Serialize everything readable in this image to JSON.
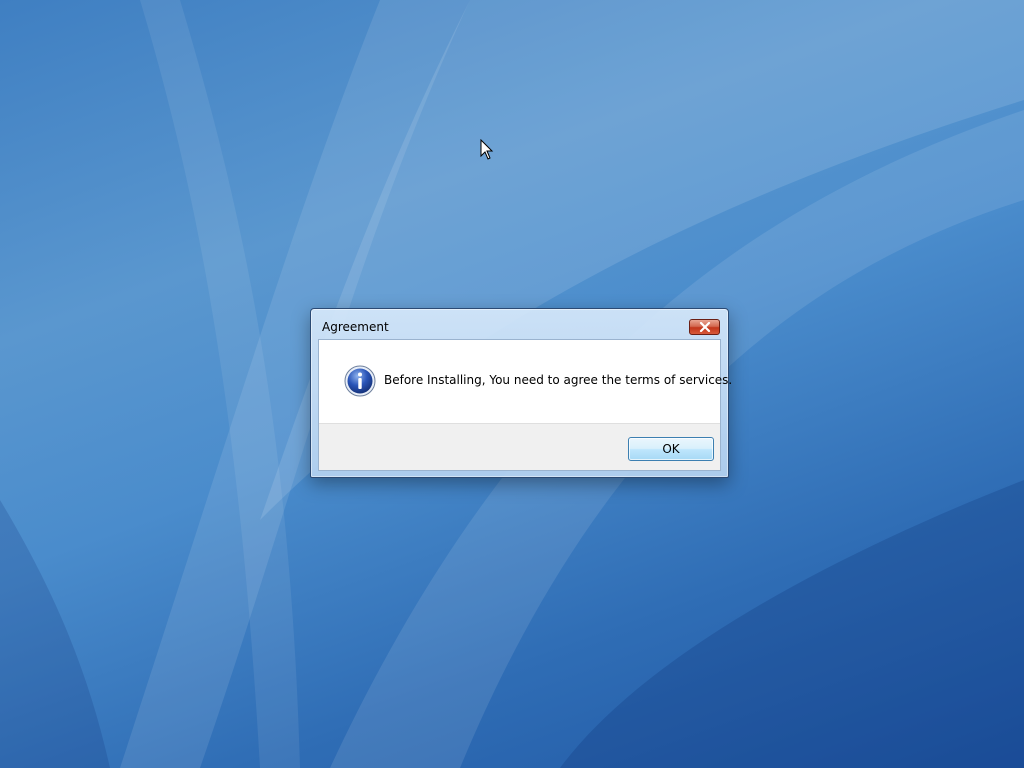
{
  "dialog": {
    "title": "Agreement",
    "message": "Before Installing, You need to agree the terms of services.",
    "ok_label": "OK",
    "icon": "info-icon",
    "close_icon": "close-icon"
  },
  "colors": {
    "desktop_blue": "#3f7fc2",
    "close_button_red": "#c2361b",
    "ok_button_border": "#3c7fb1",
    "button_area_gray": "#f0f0f0"
  }
}
